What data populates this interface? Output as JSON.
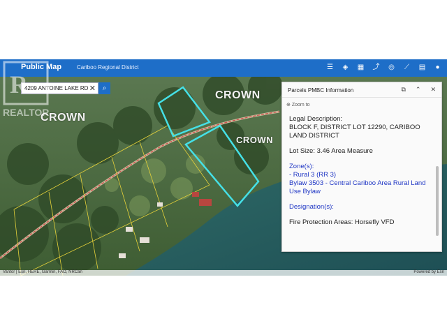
{
  "header": {
    "app_title": "Public Map",
    "org_name": "Cariboo Regional District",
    "tool_icons": [
      "list-icon",
      "layers-icon",
      "basemap-icon",
      "share-icon",
      "database-icon",
      "measure-icon",
      "print-icon",
      "user-icon"
    ]
  },
  "search": {
    "value": "4209 ANTOINE LAKE RD"
  },
  "map_labels": {
    "crown_a": "CROWN",
    "crown_b": "CROWN",
    "crown_c": "CROWN"
  },
  "panel": {
    "title": "Parcels PMBC Information",
    "zoom_label": "Zoom to",
    "legal_label": "Legal Description:",
    "legal_value": "BLOCK F, DISTRICT LOT 12290, CARIBOO LAND DISTRICT",
    "lot_size": "Lot Size: 3.46 Area Measure",
    "zones_label": "Zone(s):",
    "zone_1": "- Rural 3 (RR 3)",
    "zone_2": "Bylaw 3503 - Central Cariboo Area Rural Land Use Bylaw",
    "designation_label": "Designation(s):",
    "fire": "Fire Protection Areas: Horsefly VFD"
  },
  "attribution": {
    "left": "Vantor | Esri, HERE, Garmin, FAO, NRCan",
    "right": "Powered by Esri"
  },
  "watermark": "REALTOR",
  "colors": {
    "header": "#1e6ec8",
    "parcel_highlight": "#45e0e6",
    "parcel_lines": "#e6d23a",
    "road": "#d04a4a"
  }
}
